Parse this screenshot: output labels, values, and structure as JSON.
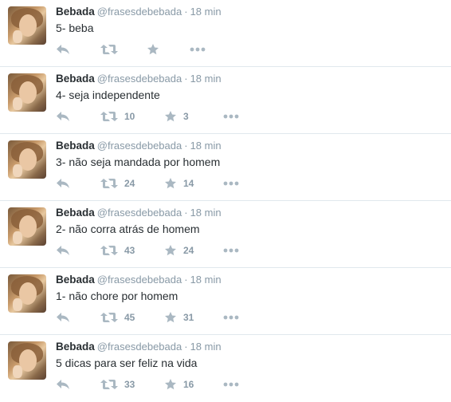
{
  "tweets": [
    {
      "fullname": "Bebada",
      "username": "@frasesdebebada",
      "separator": "·",
      "time": "18 min",
      "text": "5- beba",
      "retweets": "",
      "favorites": ""
    },
    {
      "fullname": "Bebada",
      "username": "@frasesdebebada",
      "separator": "·",
      "time": "18 min",
      "text": "4- seja independente",
      "retweets": "10",
      "favorites": "3"
    },
    {
      "fullname": "Bebada",
      "username": "@frasesdebebada",
      "separator": "·",
      "time": "18 min",
      "text": "3- não seja mandada por homem",
      "retweets": "24",
      "favorites": "14"
    },
    {
      "fullname": "Bebada",
      "username": "@frasesdebebada",
      "separator": "·",
      "time": "18 min",
      "text": "2- não corra atrás de homem",
      "retweets": "43",
      "favorites": "24"
    },
    {
      "fullname": "Bebada",
      "username": "@frasesdebebada",
      "separator": "·",
      "time": "18 min",
      "text": "1- não chore por homem",
      "retweets": "45",
      "favorites": "31"
    },
    {
      "fullname": "Bebada",
      "username": "@frasesdebebada",
      "separator": "·",
      "time": "18 min",
      "text": "5 dicas para ser feliz na vida",
      "retweets": "33",
      "favorites": "16"
    }
  ],
  "icons": {
    "reply": "reply-icon",
    "retweet": "retweet-icon",
    "favorite": "star-icon",
    "more": "more-dots-icon"
  },
  "colors": {
    "text": "#292f33",
    "muted": "#8899a6",
    "icon": "#aab8c2",
    "divider": "#e1e8ed"
  }
}
